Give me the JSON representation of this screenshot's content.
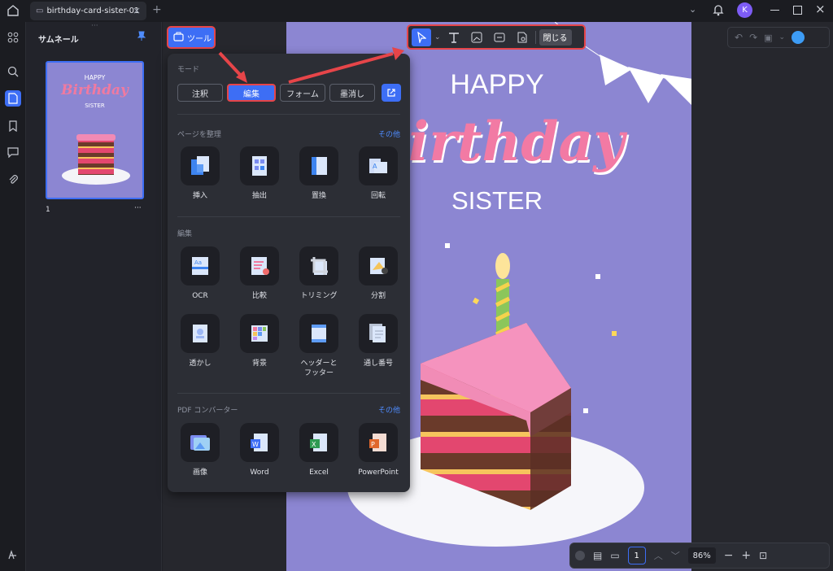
{
  "tab": {
    "title": "birthday-card-sister-01"
  },
  "window": {
    "account_initial": "K"
  },
  "thumbnails": {
    "title": "サムネール",
    "page_number": "1",
    "more": "···"
  },
  "toolbar": {
    "tools_label": "ツール",
    "close_label": "閉じる"
  },
  "card": {
    "happy": "HAPPY",
    "birthday": "Birthday",
    "sister": "SISTER",
    "big_birthday": "irthday"
  },
  "tools_panel": {
    "mode_label": "モード",
    "modes": [
      "注釈",
      "編集",
      "フォーム",
      "墨消し"
    ],
    "selected_mode": "編集",
    "organize_label": "ページを整理",
    "organize_more": "その他",
    "organize_tools": [
      "挿入",
      "抽出",
      "置換",
      "回転"
    ],
    "edit_label": "編集",
    "edit_tools": [
      "OCR",
      "比較",
      "トリミング",
      "分割",
      "透かし",
      "背景",
      "ヘッダーと\nフッター",
      "通し番号"
    ],
    "converter_label": "PDF コンバーター",
    "converter_more": "その他",
    "converter_tools": [
      "画像",
      "Word",
      "Excel",
      "PowerPoint"
    ]
  },
  "bottom": {
    "page": "1",
    "zoom": "86%"
  },
  "colors": {
    "accent": "#3d6ef5",
    "highlight": "#e64549",
    "canvas": "#8c86d2",
    "pink": "#f07aa0"
  }
}
